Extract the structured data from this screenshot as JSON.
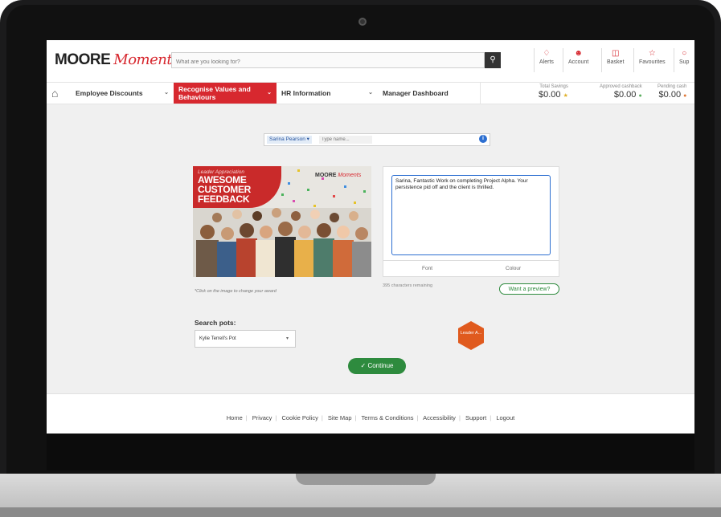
{
  "brand": {
    "name": "MOORE",
    "script": "Moments",
    "accent": "#d7282f"
  },
  "search": {
    "placeholder": "What are you looking for?"
  },
  "utilities": [
    {
      "icon": "bell-icon",
      "label": "Alerts"
    },
    {
      "icon": "user-icon",
      "label": "Account"
    },
    {
      "icon": "basket-icon",
      "label": "Basket"
    },
    {
      "icon": "star-icon",
      "label": "Favourites"
    },
    {
      "icon": "support-icon",
      "label": "Sup"
    }
  ],
  "nav": {
    "items": [
      {
        "label": "Employee Discounts"
      },
      {
        "label": "Recognise Values and Behaviours"
      },
      {
        "label": "HR Information"
      },
      {
        "label": "Manager Dashboard"
      }
    ],
    "stats": [
      {
        "label": "Total Savings",
        "value": "$0.00"
      },
      {
        "label": "Approved cashback",
        "value": "$0.00"
      },
      {
        "label": "Pending cash",
        "value": "$0.00"
      }
    ]
  },
  "recipient": {
    "chip": "Sarina Pearson",
    "placeholder": "Type name..."
  },
  "card": {
    "kicker": "Leader Appreciation",
    "headline_1": "AWESOME CUSTOMER",
    "headline_2": "FEEDBACK",
    "brand": "MOORE",
    "brand_script": "Moments",
    "hint": "*Click on the image to change your award"
  },
  "message": {
    "text": "Sarina, Fantastic Work on completing Project Alpha. Your persistence pid off and the client is thrilled.",
    "tools": [
      "Font",
      "Colour"
    ],
    "remaining": "395 characters remaining",
    "preview_label": "Want a preview?"
  },
  "pots": {
    "label": "Search pots:",
    "selected": "Kylie Terrell's Pot"
  },
  "badge": {
    "label": "Leader A..."
  },
  "continue_label": "Continue",
  "footer": [
    "Home",
    "Privacy",
    "Cookie Policy",
    "Site Map",
    "Terms & Conditions",
    "Accessibility",
    "Support",
    "Logout"
  ]
}
